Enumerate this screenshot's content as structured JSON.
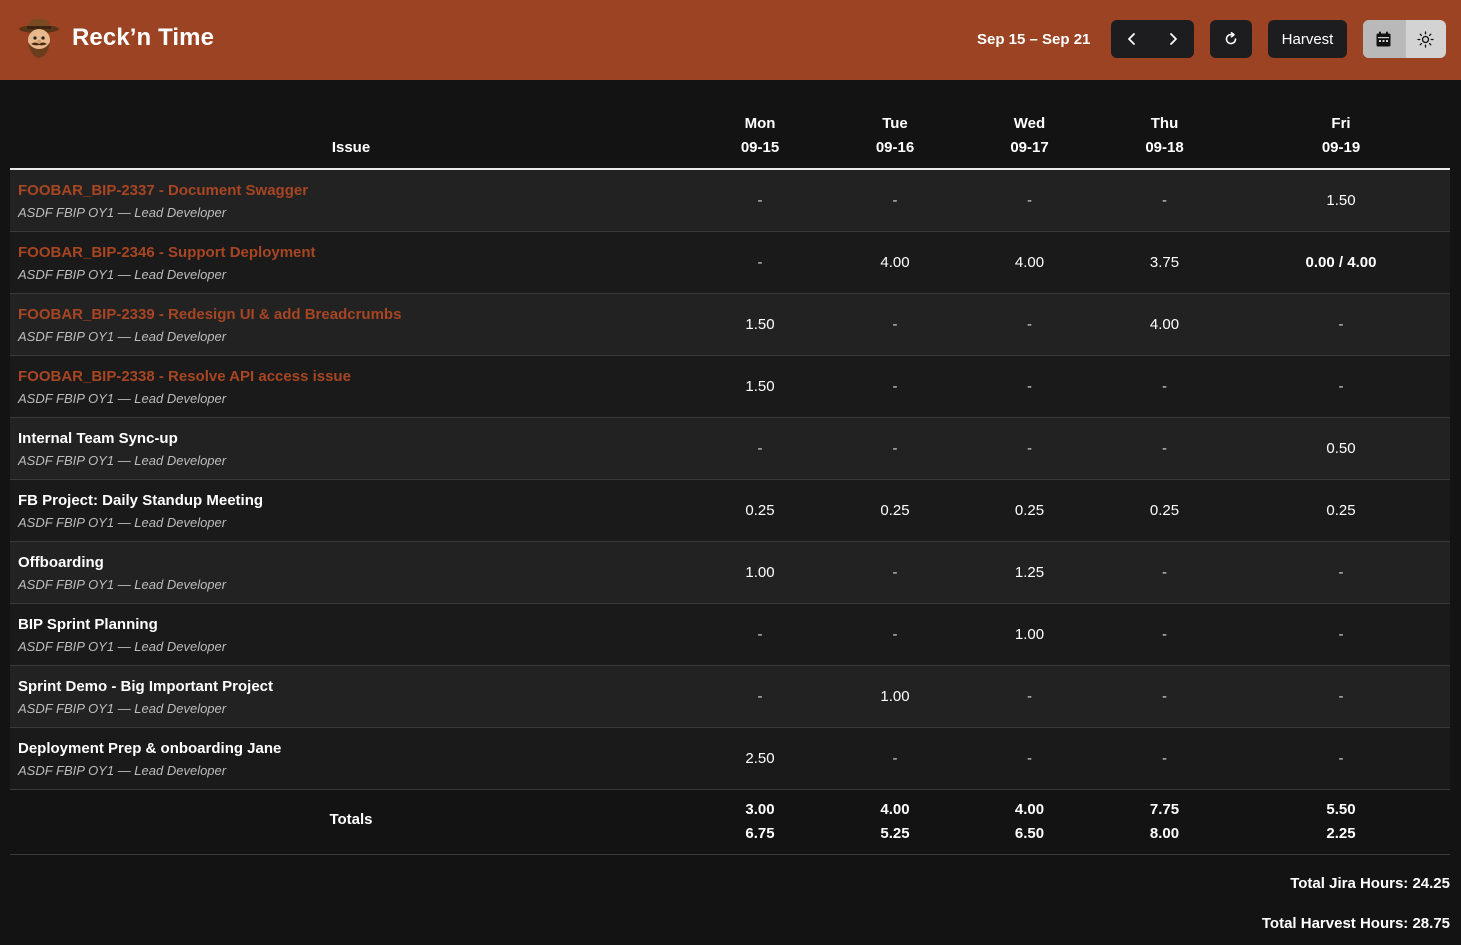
{
  "header": {
    "app_title": "Reck’n Time",
    "week_range": "Sep 15 – Sep 21",
    "harvest_label": "Harvest",
    "icons": {
      "prev": "chevron-left-icon",
      "next": "chevron-right-icon",
      "refresh": "refresh-icon",
      "calendar": "calendar-icon",
      "theme": "sun-icon"
    }
  },
  "colors": {
    "brand": "#9b4322",
    "link": "#a84522",
    "background": "#131313"
  },
  "table": {
    "issue_header": "Issue",
    "days": [
      {
        "name": "Mon",
        "date": "09-15"
      },
      {
        "name": "Tue",
        "date": "09-16"
      },
      {
        "name": "Wed",
        "date": "09-17"
      },
      {
        "name": "Thu",
        "date": "09-18"
      },
      {
        "name": "Fri",
        "date": "09-19"
      }
    ],
    "rows": [
      {
        "title": "FOOBAR_BIP-2337 - Document Swagger",
        "subtitle": "ASDF FBIP OY1 — Lead Developer",
        "values": [
          "-",
          "-",
          "-",
          "-",
          "1.50"
        ]
      },
      {
        "title": "FOOBAR_BIP-2346 - Support Deployment",
        "subtitle": "ASDF FBIP OY1 — Lead Developer",
        "values": [
          "-",
          "4.00",
          "4.00",
          "3.75",
          "0.00 / 4.00"
        ]
      },
      {
        "title": "FOOBAR_BIP-2339 - Redesign UI & add Breadcrumbs",
        "subtitle": "ASDF FBIP OY1 — Lead Developer",
        "values": [
          "1.50",
          "-",
          "-",
          "4.00",
          "-"
        ]
      },
      {
        "title": "FOOBAR_BIP-2338 - Resolve API access issue",
        "subtitle": "ASDF FBIP OY1 — Lead Developer",
        "values": [
          "1.50",
          "-",
          "-",
          "-",
          "-"
        ]
      },
      {
        "title": "Internal Team Sync-up",
        "subtitle": "ASDF FBIP OY1 — Lead Developer",
        "values": [
          "-",
          "-",
          "-",
          "-",
          "0.50"
        ]
      },
      {
        "title": "FB Project: Daily Standup Meeting",
        "subtitle": "ASDF FBIP OY1 — Lead Developer",
        "values": [
          "0.25",
          "0.25",
          "0.25",
          "0.25",
          "0.25"
        ]
      },
      {
        "title": "Offboarding",
        "subtitle": "ASDF FBIP OY1 — Lead Developer",
        "values": [
          "1.00",
          "-",
          "1.25",
          "-",
          "-"
        ]
      },
      {
        "title": "BIP Sprint Planning",
        "subtitle": "ASDF FBIP OY1 — Lead Developer",
        "values": [
          "-",
          "-",
          "1.00",
          "-",
          "-"
        ]
      },
      {
        "title": "Sprint Demo - Big Important Project",
        "subtitle": "ASDF FBIP OY1 — Lead Developer",
        "values": [
          "-",
          "1.00",
          "-",
          "-",
          "-"
        ]
      },
      {
        "title": "Deployment Prep & onboarding Jane",
        "subtitle": "ASDF FBIP OY1 — Lead Developer",
        "values": [
          "2.50",
          "-",
          "-",
          "-",
          "-"
        ]
      }
    ],
    "totals": {
      "label": "Totals",
      "jira": [
        "3.00",
        "4.00",
        "4.00",
        "7.75",
        "5.50"
      ],
      "harvest": [
        "6.75",
        "5.25",
        "6.50",
        "8.00",
        "2.25"
      ]
    }
  },
  "summary": {
    "jira_total": "Total Jira Hours: 24.25",
    "harvest_total": "Total Harvest Hours: 28.75"
  }
}
